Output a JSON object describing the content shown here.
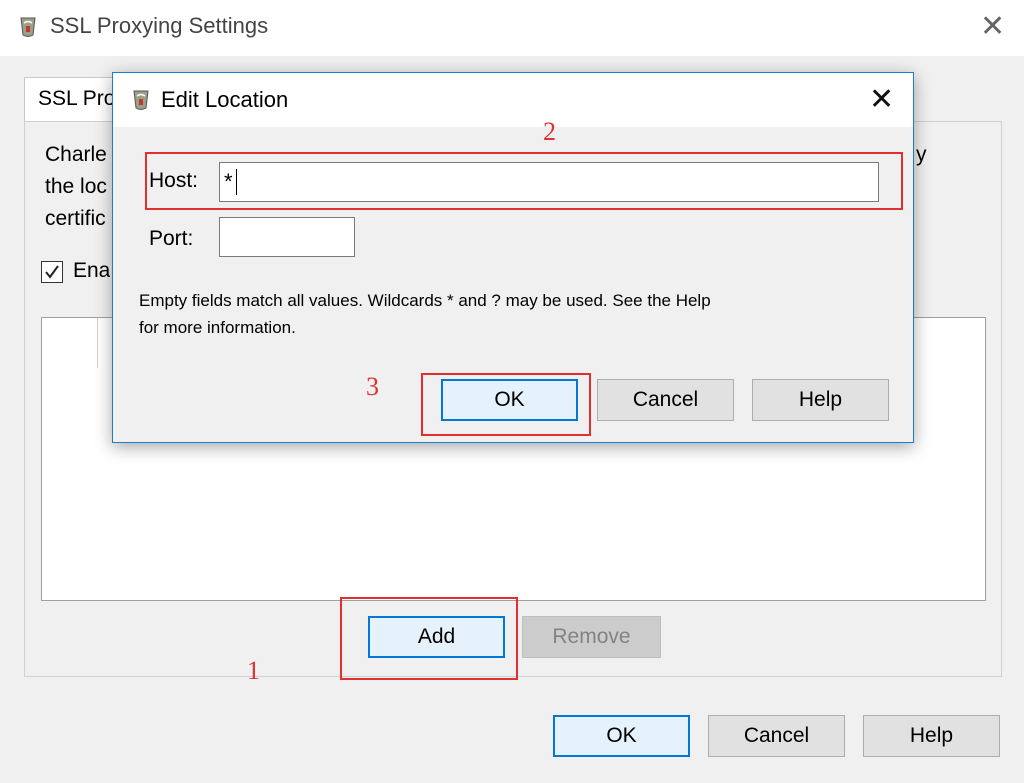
{
  "main_window": {
    "title": "SSL Proxying Settings",
    "tab_label": "SSL Pro",
    "description_lines": [
      "Charle",
      "the loc",
      "certific"
    ],
    "description_tail": "y",
    "enable_label": "Ena",
    "buttons": {
      "add": "Add",
      "remove": "Remove",
      "ok": "OK",
      "cancel": "Cancel",
      "help": "Help"
    }
  },
  "dialog": {
    "title": "Edit Location",
    "host_label": "Host:",
    "host_value": "*",
    "port_label": "Port:",
    "port_value": "",
    "note_lines": [
      "Empty fields match all values. Wildcards * and ? may be used. See the Help",
      "for more information."
    ],
    "buttons": {
      "ok": "OK",
      "cancel": "Cancel",
      "help": "Help"
    }
  },
  "annotations": {
    "step1": "1",
    "step2": "2",
    "step3": "3"
  },
  "colors": {
    "accent": "#0078d7",
    "annotation_red": "#e03030"
  },
  "icons": {
    "app": "charles-app-icon",
    "close": "close-icon",
    "check": "checkmark-icon"
  }
}
